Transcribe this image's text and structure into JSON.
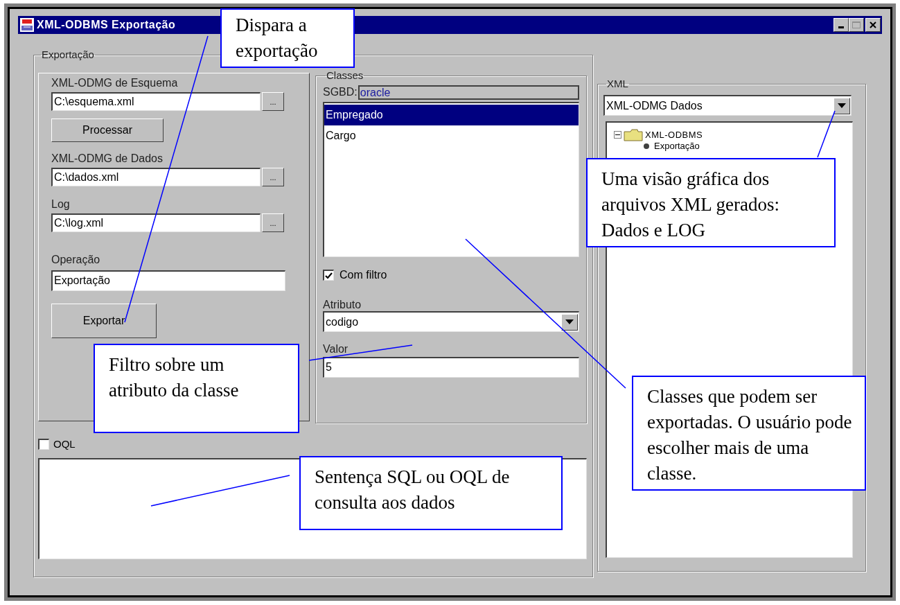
{
  "window": {
    "title": "XML-ODBMS Exportação"
  },
  "export_group": {
    "title": "Exportação",
    "schema": {
      "label": "XML-ODMG de Esquema",
      "value": "C:\\esquema.xml",
      "browse": "..."
    },
    "process_button": "Processar",
    "data": {
      "label": "XML-ODMG de Dados",
      "value": "C:\\dados.xml",
      "browse": "..."
    },
    "log": {
      "label": "Log",
      "value": "C:\\log.xml",
      "browse": "..."
    },
    "operation": {
      "label": "Operação",
      "value": "Exportação"
    },
    "export_button": "Exportar"
  },
  "classes": {
    "title": "Classes",
    "sgbd_label": "SGBD:",
    "sgbd_value": "oracle",
    "items": [
      {
        "label": "Empregado",
        "selected": true
      },
      {
        "label": "Cargo",
        "selected": false
      }
    ],
    "filter": {
      "label": "Com filtro",
      "checked": true
    },
    "attribute": {
      "label": "Atributo",
      "value": "codigo"
    },
    "value": {
      "label": "Valor",
      "value": "5"
    }
  },
  "oql": {
    "label": "OQL",
    "checked": false
  },
  "xml": {
    "title": "XML",
    "document": "XML-ODMG Dados",
    "tree": [
      {
        "label": "XML-ODBMS",
        "expanded": true,
        "children": [
          {
            "label": "Exportação"
          }
        ]
      }
    ]
  },
  "callouts": [
    {
      "text": "Dispara a exportação"
    },
    {
      "text": "Uma visão gráfica dos arquivos XML gerados: Dados e LOG"
    },
    {
      "text": "Filtro sobre um atributo da classe"
    },
    {
      "text": "Classes que podem ser exportadas. O usuário pode escolher mais de uma classe."
    },
    {
      "text": "Sentença SQL ou OQL de consulta aos dados"
    }
  ]
}
